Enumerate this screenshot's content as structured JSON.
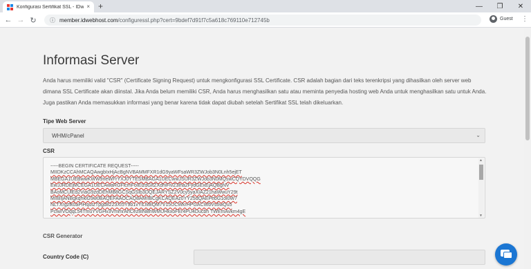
{
  "browser": {
    "tab_title": "Konfigurasi Sertifikat SSL - IDwebhost",
    "tab_close": "×",
    "new_tab": "+",
    "url_host": "member.idwebhost.com",
    "url_path": "/configuressl.php?cert=9bdef7d91f7c5a618c769110e712745b",
    "profile_label": "Guest",
    "window_controls": [
      "—",
      "❐",
      "✕"
    ],
    "nav": {
      "back": "←",
      "forward": "→",
      "reload": "↻"
    },
    "lock_icon": "ⓘ",
    "menu_icon": "⋮"
  },
  "page": {
    "heading": "Informasi Server",
    "intro": "Anda harus memiliki valid \"CSR\" (Certificate Signing Request) untuk mengkonfigurasi SSL Certificate. CSR adalah bagian dari teks terenkripsi yang dihasilkan oleh server web dimana SSL Certificate akan diinstal. Jika Anda belum memiliki CSR, Anda harus menghasilkan satu atau meminta penyedia hosting web Anda untuk menghasilkan satu untuk Anda. Juga pastikan Anda memasukkan informasi yang benar karena tidak dapat diubah setelah Sertifikat SSL telah dikeluarkan.",
    "server_type_label": "Tipe Web Server",
    "server_type_value": "WHM/cPanel",
    "csr_label": "CSR",
    "csr_lines": [
      "-----BEGIN CERTIFICATE REQUEST-----",
      "MIIDKzCCAhMCAQAwgbIxHjAcBgNVBAMMFXR1dG9yaWFsaWR3ZWJob3N0Lnh5ejET",
      "MBEGA1UEBwwKWW9neWFrYXJ0YTESMBAGA1UECwwJSUR3ZWJob3N0MQswCQYDVQQG",
      "EwJJRDEjMCEGA1UECAwaRGFlcmFoIElzdGltZXdhIFlvZ3lha2FydGExEjAQBgNV",
      "BAoMCUlEd2ViaG9zdDEhMB8GCSqGSIb3DQEJARYSZ2V0cy5yaXIAZ21haWwuY29t",
      "MIIBIjANBgkqhkiG9w0BAQEFAAOCAQ8AMIIBCgKCAQEAz0YY25dQAEPebG1oi0W7",
      "NLTXrgzfk0aPiHqutzTpgd8223XI5Y9b1vYlLM8QM7V15UCWkrHPGACWbVs6wQu5",
      "Pclw/VOqqL54TmuYVGHv3VmmrAhCez8INBhWMUHkxoFEr4PU4Ducbh TWEmAvkm4gE"
    ],
    "csr_generator_label": "CSR Generator",
    "country_code_label": "Country Code (C)",
    "select_chevron": "⌄"
  },
  "colors": {
    "page_bg": "#f2f2f2",
    "chat_button": "#1b76d3",
    "spell_underline": "#d93025"
  },
  "icons": {
    "chat": "chat-bubbles-icon"
  }
}
